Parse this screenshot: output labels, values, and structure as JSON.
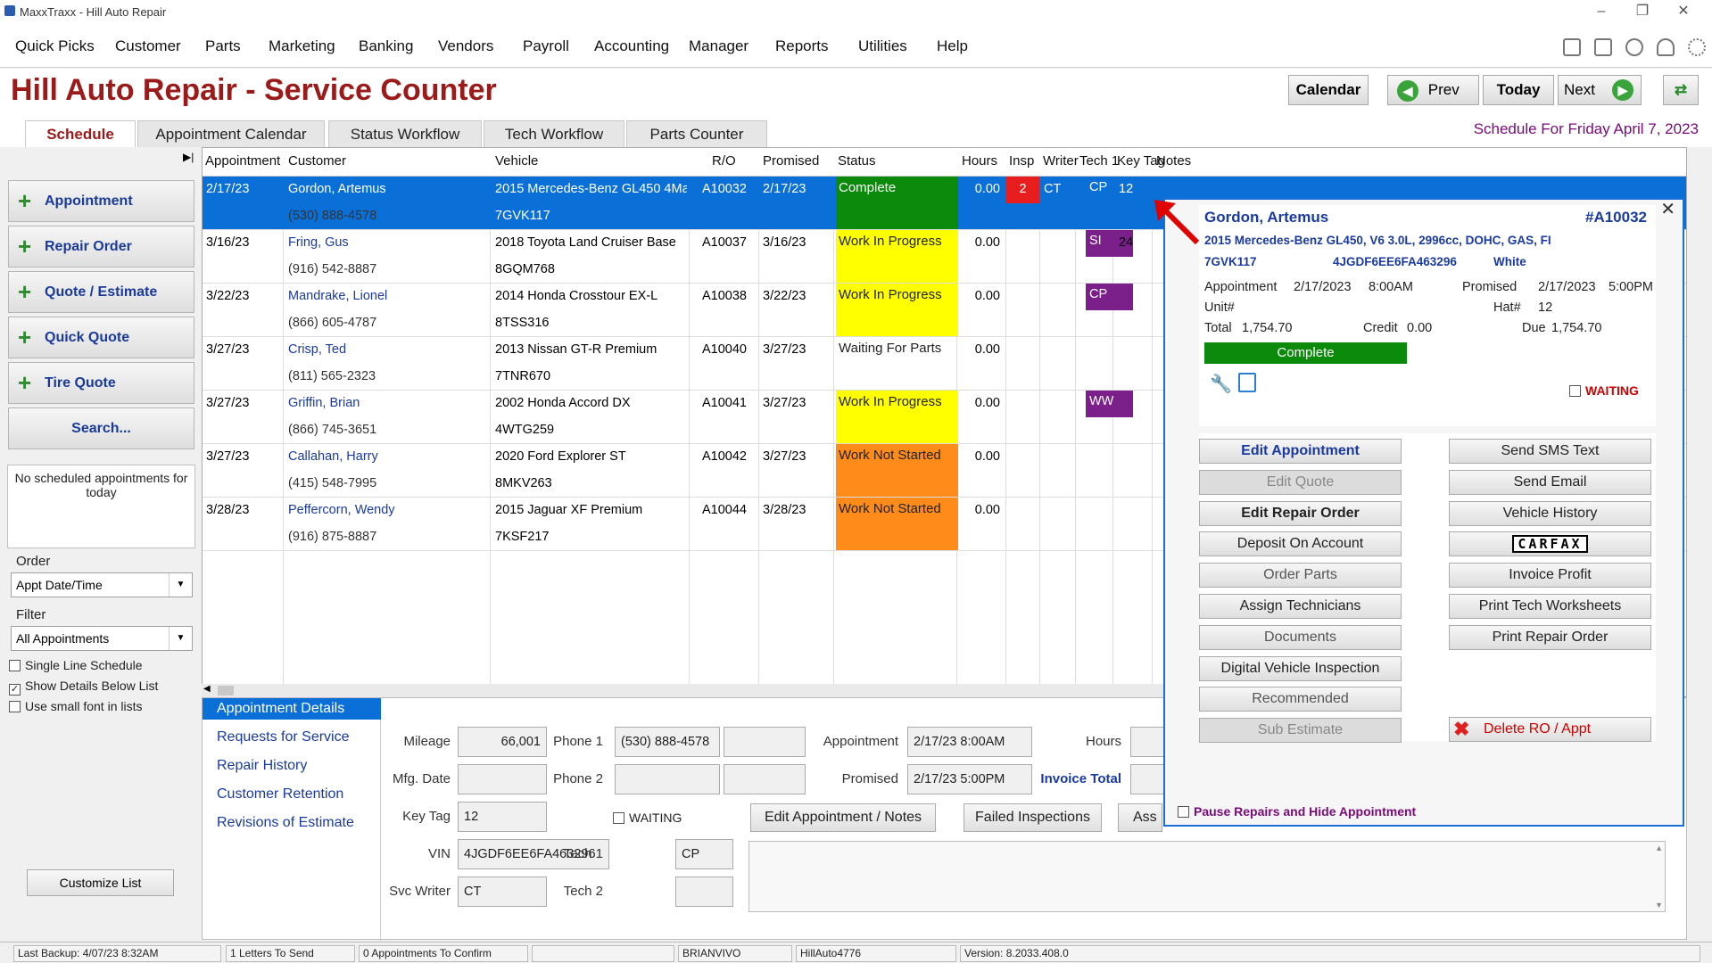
{
  "window": {
    "title": "MaxxTraxx - Hill Auto Repair"
  },
  "menu": [
    "Quick Picks",
    "Customer",
    "Parts",
    "Marketing",
    "Banking",
    "Vendors",
    "Payroll",
    "Accounting",
    "Manager",
    "Reports",
    "Utilities",
    "Help"
  ],
  "header": {
    "title": "Hill Auto Repair - Service Counter",
    "calendar": "Calendar",
    "prev": "Prev",
    "today": "Today",
    "next": "Next",
    "schedule_for": "Schedule For Friday April  7, 2023"
  },
  "tabs": [
    "Schedule",
    "Appointment Calendar",
    "Status Workflow",
    "Tech Workflow",
    "Parts Counter"
  ],
  "sidebar": {
    "buttons": [
      "Appointment",
      "Repair Order",
      "Quote / Estimate",
      "Quick Quote",
      "Tire Quote"
    ],
    "search": "Search...",
    "no_appts": "No scheduled appointments for today",
    "order_label": "Order",
    "order_value": "Appt Date/Time",
    "filter_label": "Filter",
    "filter_value": "All Appointments",
    "checks": [
      {
        "label": "Single Line Schedule",
        "checked": false
      },
      {
        "label": "Show Details Below List",
        "checked": true
      },
      {
        "label": "Use small font in lists",
        "checked": false
      }
    ],
    "customize": "Customize List"
  },
  "grid": {
    "headers": [
      "Appointment",
      "Customer",
      "Vehicle",
      "R/O",
      "Promised",
      "Status",
      "Hours",
      "Insp",
      "Writer",
      "Tech 1",
      "Key Tag",
      "Notes"
    ],
    "rows": [
      {
        "appt": "2/17/23",
        "name": "Gordon, Artemus",
        "phone": "(530) 888-4578",
        "vehicle": "2015 Mercedes-Benz  GL450 4Ma",
        "plate": "7GVK117",
        "ro": "A10032",
        "promised": "2/17/23",
        "status": "Complete",
        "status_color": "#0b8a0b",
        "hours": "0.00",
        "insp": "2",
        "writer": "CT",
        "tech": "CP",
        "tech_color": "",
        "keytag": "12"
      },
      {
        "appt": "3/16/23",
        "name": "Fring, Gus",
        "phone": "(916) 542-8887",
        "vehicle": "2018 Toyota  Land Cruiser Base",
        "plate": "8GQM768",
        "ro": "A10037",
        "promised": "3/16/23",
        "status": "Work In Progress",
        "status_color": "#ffff00",
        "hours": "0.00",
        "insp": "",
        "writer": "",
        "tech": "SI",
        "tech_color": "#7b1f8a",
        "keytag": "24"
      },
      {
        "appt": "3/22/23",
        "name": "Mandrake, Lionel",
        "phone": "(866) 605-4787",
        "vehicle": "2014 Honda  Crosstour EX-L",
        "plate": "8TSS316",
        "ro": "A10038",
        "promised": "3/22/23",
        "status": "Work In Progress",
        "status_color": "#ffff00",
        "hours": "0.00",
        "insp": "",
        "writer": "",
        "tech": "CP",
        "tech_color": "#7b1f8a",
        "keytag": ""
      },
      {
        "appt": "3/27/23",
        "name": "Crisp, Ted",
        "phone": "(811) 565-2323",
        "vehicle": "2013 Nissan  GT-R Premium",
        "plate": "7TNR670",
        "ro": "A10040",
        "promised": "3/27/23",
        "status": "Waiting For Parts",
        "status_color": "",
        "hours": "0.00",
        "insp": "",
        "writer": "",
        "tech": "",
        "tech_color": "",
        "keytag": ""
      },
      {
        "appt": "3/27/23",
        "name": "Griffin, Brian",
        "phone": "(866) 745-3651",
        "vehicle": "2002 Honda  Accord DX",
        "plate": "4WTG259",
        "ro": "A10041",
        "promised": "3/27/23",
        "status": "Work In Progress",
        "status_color": "#ffff00",
        "hours": "0.00",
        "insp": "",
        "writer": "",
        "tech": "WW",
        "tech_color": "#7b1f8a",
        "keytag": ""
      },
      {
        "appt": "3/27/23",
        "name": "Callahan, Harry",
        "phone": "(415) 548-7995",
        "vehicle": "2020 Ford  Explorer ST",
        "plate": "8MKV263",
        "ro": "A10042",
        "promised": "3/27/23",
        "status": "Work Not Started",
        "status_color": "#ff8c1a",
        "hours": "0.00",
        "insp": "",
        "writer": "",
        "tech": "",
        "tech_color": "",
        "keytag": ""
      },
      {
        "appt": "3/28/23",
        "name": "Peffercorn, Wendy",
        "phone": "(916) 875-8887",
        "vehicle": "2015 Jaguar  XF Premium",
        "plate": "7KSF217",
        "ro": "A10044",
        "promised": "3/28/23",
        "status": "Work Not Started",
        "status_color": "#ff8c1a",
        "hours": "0.00",
        "insp": "",
        "writer": "",
        "tech": "",
        "tech_color": "",
        "keytag": ""
      }
    ]
  },
  "details": {
    "links": [
      "Appointment Details",
      "Requests for Service",
      "Repair History",
      "Customer Retention",
      "Revisions of Estimate"
    ],
    "mileage_label": "Mileage",
    "mileage": "66,001",
    "mfg_label": "Mfg. Date",
    "mfg": "",
    "keytag_label": "Key Tag",
    "keytag": "12",
    "vin_label": "VIN",
    "vin": "4JGDF6EE6FA463296",
    "writer_label": "Svc Writer",
    "writer": "CT",
    "phone1_label": "Phone 1",
    "phone1": "(530) 888-4578",
    "phone2_label": "Phone 2",
    "phone2": "",
    "waiting": "WAITING",
    "tech1_label": "Tech 1",
    "tech1": "CP",
    "tech2_label": "Tech 2",
    "tech2": "",
    "appt_label": "Appointment",
    "appt": "2/17/23  8:00AM",
    "promised_label": "Promised",
    "promised": "2/17/23  5:00PM",
    "hours_label": "Hours",
    "invoice_label": "Invoice Total",
    "edit_btn": "Edit Appointment / Notes",
    "failed_btn": "Failed Inspections",
    "ass_btn": "Ass"
  },
  "popup": {
    "name": "Gordon, Artemus",
    "ro": "#A10032",
    "vehicle": "2015 Mercedes-Benz  GL450, V6 3.0L, 2996cc, DOHC, GAS, FI",
    "plate": "7GVK117",
    "vin": "4JGDF6EE6FA463296",
    "color": "White",
    "appt_label": "Appointment",
    "appt_date": "2/17/2023",
    "appt_time": "8:00AM",
    "prom_label": "Promised",
    "prom_date": "2/17/2023",
    "prom_time": "5:00PM",
    "unit_label": "Unit#",
    "hat_label": "Hat#",
    "hat": "12",
    "total_label": "Total",
    "total": "1,754.70",
    "credit_label": "Credit",
    "credit": "0.00",
    "due_label": "Due",
    "due": "1,754.70",
    "status": "Complete",
    "waiting": "WAITING",
    "left_buttons": [
      {
        "label": "Edit Appointment",
        "style": "bold-blue"
      },
      {
        "label": "Edit Quote",
        "style": "dis"
      },
      {
        "label": "Edit Repair Order",
        "style": "bold"
      },
      {
        "label": "Deposit On Account",
        "style": ""
      },
      {
        "label": "Order Parts",
        "style": "gray"
      },
      {
        "label": "Assign Technicians",
        "style": ""
      },
      {
        "label": "Documents",
        "style": "gray"
      },
      {
        "label": "Digital Vehicle Inspection",
        "style": ""
      },
      {
        "label": "Recommended",
        "style": "gray"
      },
      {
        "label": "Sub Estimate",
        "style": "dis"
      }
    ],
    "right_buttons": [
      "Send SMS Text",
      "Send Email",
      "Vehicle History",
      "CARFAX",
      "Invoice Profit",
      "Print Tech Worksheets",
      "Print Repair Order"
    ],
    "delete": "Delete RO / Appt",
    "pause": "Pause Repairs and Hide Appointment"
  },
  "statusbar": [
    "Last Backup:  4/07/23   8:32AM",
    "1 Letters To Send",
    "0 Appointments To Confirm",
    "",
    "BRIANVIVO",
    "HillAuto4776",
    "Version:  8.2033.408.0"
  ]
}
